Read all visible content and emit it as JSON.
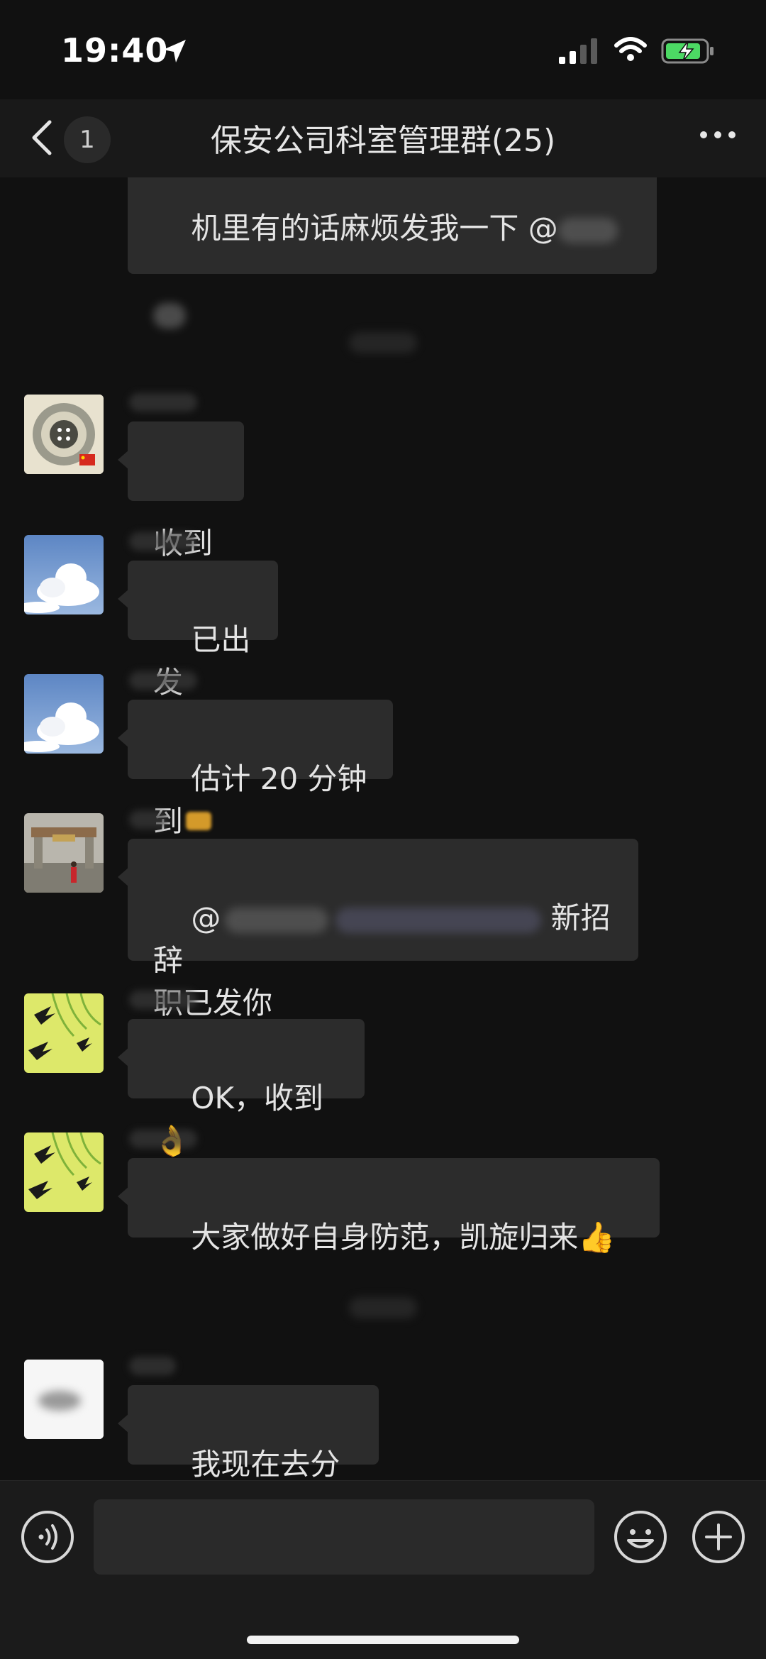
{
  "status_bar": {
    "time": "19:40"
  },
  "header": {
    "back_count": "1",
    "title": "保安公司科室管理群(25)"
  },
  "messages": [
    {
      "text": "机里有的话麻烦发我一下 @"
    },
    {
      "text": "收到"
    },
    {
      "text": "已出发"
    },
    {
      "text": "估计 20 分钟到"
    },
    {
      "text_prefix": "@",
      "text_suffix": " 新招辞\n职已发你"
    },
    {
      "text": "OK，收到👌"
    },
    {
      "text": "大家做好自身防范，凯旋归来👍"
    },
    {
      "text": "我现在去分局"
    }
  ],
  "icons": [
    "location-arrow-icon",
    "signal-icon",
    "wifi-icon",
    "battery-charging-icon",
    "back-chevron-icon",
    "more-icon",
    "voice-icon",
    "emoji-icon",
    "plus-icon"
  ],
  "colors": {
    "background": "#111111",
    "bubble": "#2c2c2c",
    "battery": "#4cd964"
  }
}
